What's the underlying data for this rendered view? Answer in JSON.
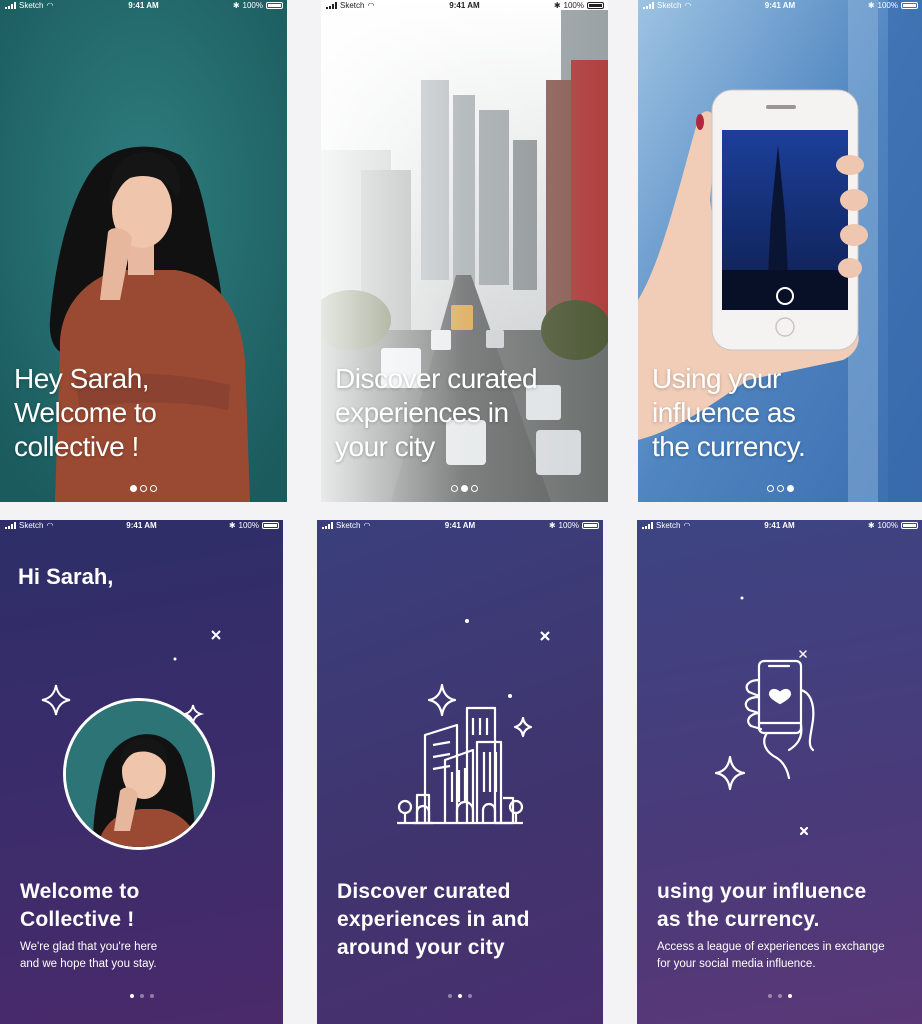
{
  "status": {
    "carrier": "Sketch",
    "time": "9:41 AM",
    "battery": "100%"
  },
  "screens": {
    "photo_1": {
      "title_lines": [
        "Hey Sarah,",
        "Welcome to",
        "collective !"
      ]
    },
    "photo_2": {
      "title_lines": [
        "Discover curated",
        "experiences in",
        "your city"
      ]
    },
    "photo_3": {
      "title_lines": [
        "Using your",
        "influence as",
        "the currency."
      ]
    },
    "illus_1": {
      "greeting": "Hi Sarah,",
      "heading_lines": [
        "Welcome to",
        "Collective !"
      ],
      "sub_lines": [
        "We're glad that you're here",
        "and we hope that you stay."
      ]
    },
    "illus_2": {
      "heading_lines": [
        "Discover curated",
        "experiences in and",
        "around your city"
      ]
    },
    "illus_3": {
      "heading_lines": [
        "using your influence",
        "as the currency."
      ],
      "sub_lines": [
        "Access a league of experiences in exchange",
        "for your social media influence."
      ]
    }
  },
  "pager": {
    "total": 3
  },
  "icons": [
    "signal-icon",
    "wifi-icon",
    "bluetooth-icon",
    "battery-icon",
    "sparkle-icon",
    "cross-star-icon",
    "city-buildings-icon",
    "hand-phone-heart-icon",
    "profile-avatar"
  ],
  "colors": {
    "teal_bg": "#2a6a6e",
    "purple_top": "#2d2e68",
    "purple_bottom": "#4a2a6b",
    "text": "#ffffff"
  }
}
